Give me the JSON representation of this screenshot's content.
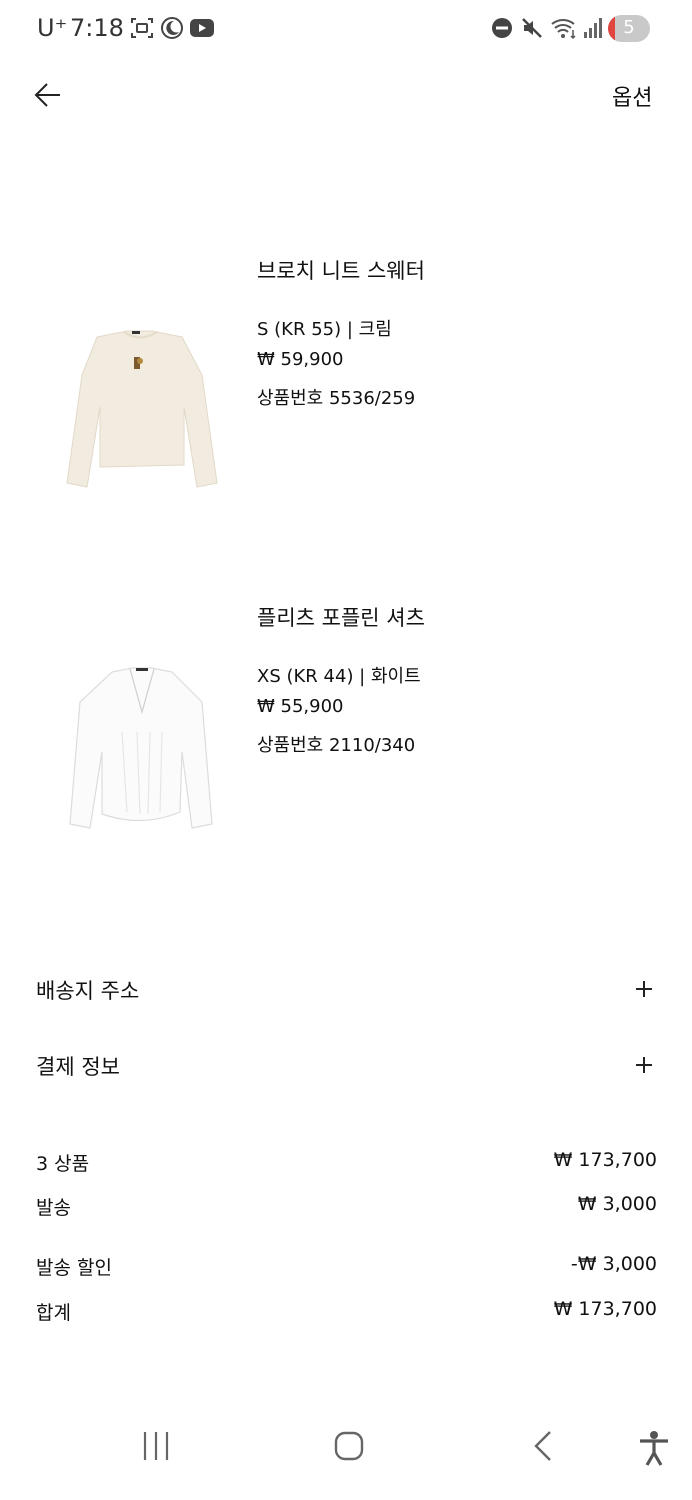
{
  "status_bar": {
    "carrier": "U⁺",
    "time": "7:18",
    "battery_level": "5",
    "icons": [
      "screenshot-icon",
      "night-mode-icon",
      "youtube-icon",
      "do-not-disturb-icon",
      "mute-icon",
      "wifi-icon",
      "signal-icon",
      "battery-icon"
    ]
  },
  "header": {
    "back_icon": "arrow-left-icon",
    "options_label": "옵션"
  },
  "products": [
    {
      "name": "브로치 니트 스웨터",
      "variant": "S (KR 55) | 크림",
      "price": "₩ 59,900",
      "product_number": "상품번호 5536/259",
      "image_color": "#f2ebdf"
    },
    {
      "name": "플리츠 포플린 셔츠",
      "variant": "XS (KR 44) | 화이트",
      "price": "₩ 55,900",
      "product_number": "상품번호 2110/340",
      "image_color": "#fafafa"
    }
  ],
  "sections": {
    "shipping_address": "배송지 주소",
    "payment_info": "결제 정보"
  },
  "summary": {
    "items_label": "3 상품",
    "items_value": "₩ 173,700",
    "shipping_label": "발송",
    "shipping_value": "₩ 3,000",
    "discount_label": "발송 할인",
    "discount_value": "-₩ 3,000",
    "total_label": "합계",
    "total_value": "₩ 173,700"
  },
  "nav_bar": {
    "icons": [
      "recent-apps-icon",
      "home-icon",
      "back-icon",
      "accessibility-icon"
    ]
  }
}
